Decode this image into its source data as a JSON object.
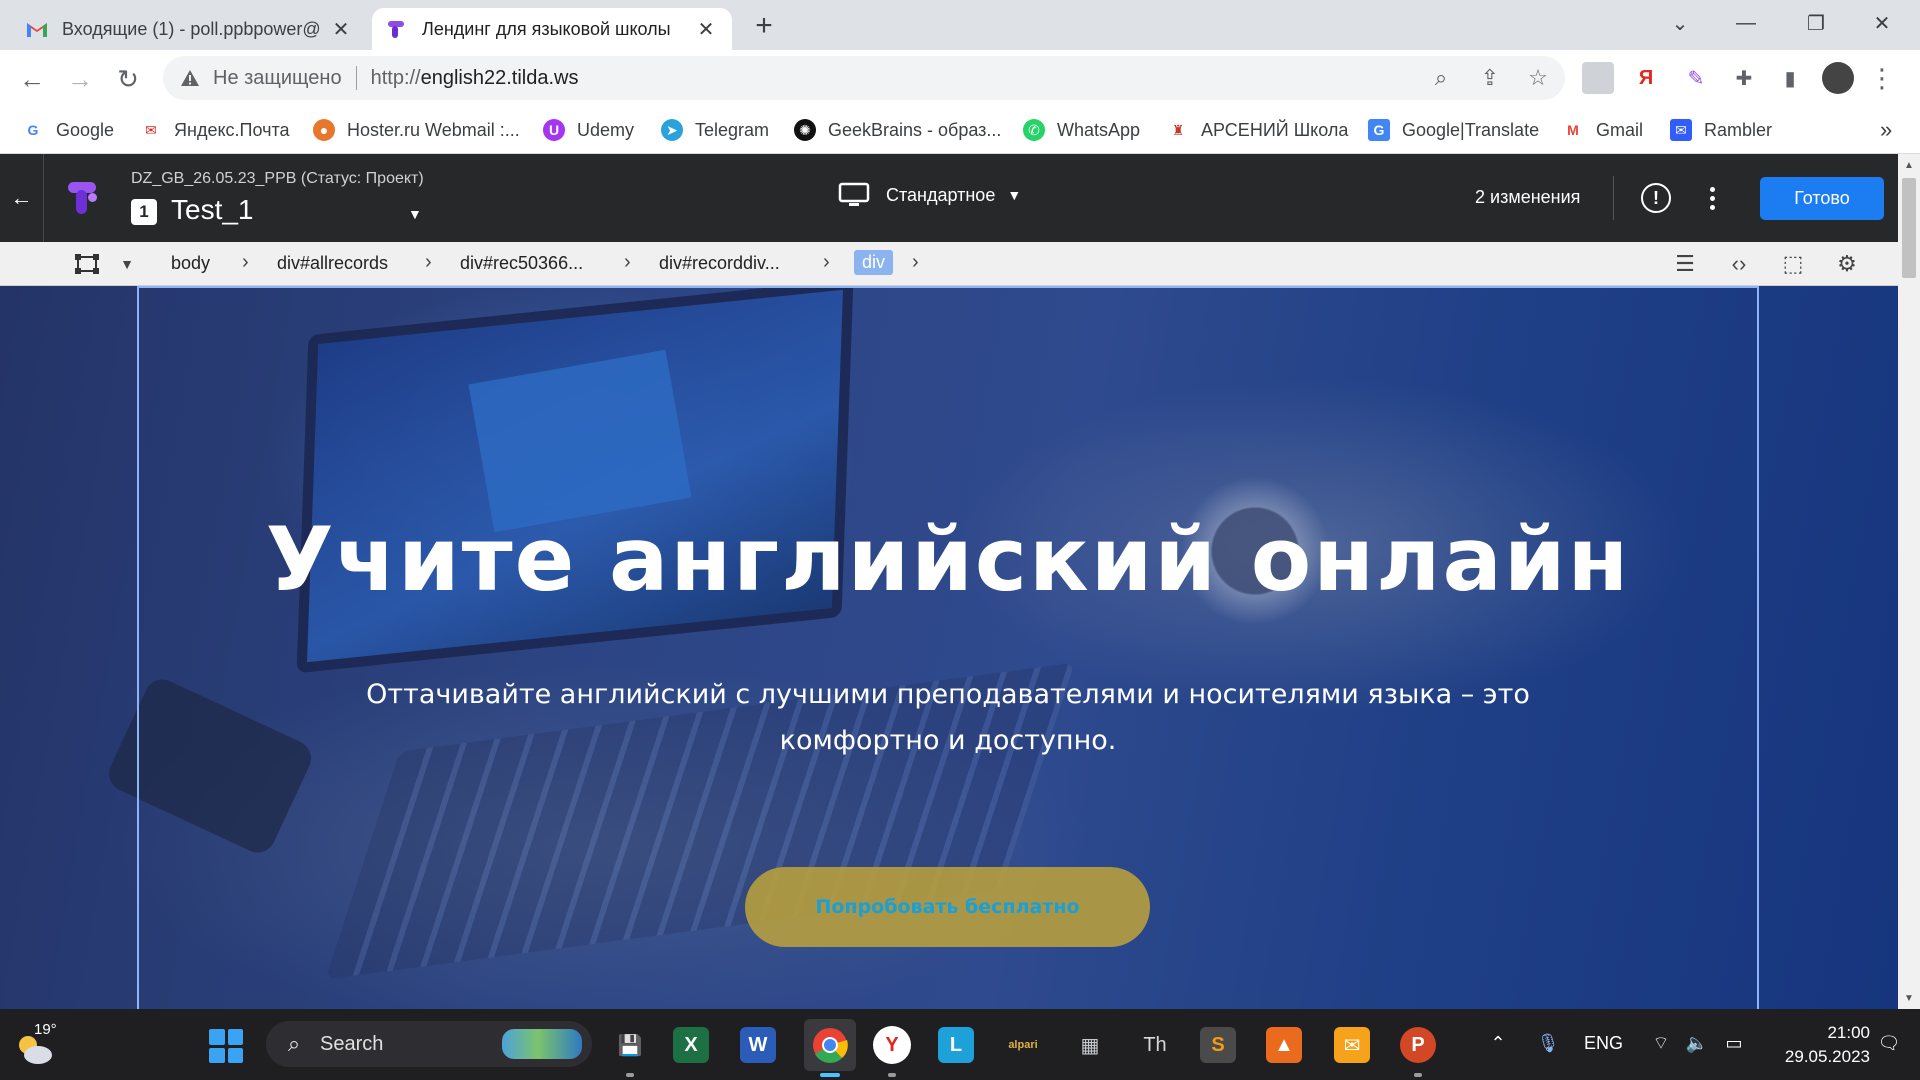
{
  "browser": {
    "tabs": [
      {
        "title": "Входящие (1) - poll.ppbpower@",
        "icon": "gmail-icon",
        "active": false
      },
      {
        "title": "Лендинг для языковой школы",
        "icon": "tilda-icon",
        "active": true
      }
    ],
    "new_tab_label": "+",
    "address": {
      "security_label": "Не защищено",
      "url_scheme": "http://",
      "url_host": "english22.tilda.ws"
    },
    "bookmarks": [
      {
        "label": "Google",
        "icon": "google-icon",
        "color": "#4285f4"
      },
      {
        "label": "Яндекс.Почта",
        "icon": "yandex-mail-icon",
        "color": "#ffcc00"
      },
      {
        "label": "Hoster.ru Webmail :...",
        "icon": "hoster-icon",
        "color": "#e8772e"
      },
      {
        "label": "Udemy",
        "icon": "udemy-icon",
        "color": "#a435f0"
      },
      {
        "label": "Telegram",
        "icon": "telegram-icon",
        "color": "#2aa3dc"
      },
      {
        "label": "GeekBrains - образ...",
        "icon": "geekbrains-icon",
        "color": "#111111"
      },
      {
        "label": "WhatsApp",
        "icon": "whatsapp-icon",
        "color": "#25d366"
      },
      {
        "label": "АРСЕНИЙ Школа",
        "icon": "arseniy-icon",
        "color": "#c0392b"
      },
      {
        "label": "Google|Translate",
        "icon": "translate-icon",
        "color": "#4285f4"
      },
      {
        "label": "Gmail",
        "icon": "gmail-icon",
        "color": "#ea4335"
      },
      {
        "label": "Rambler",
        "icon": "rambler-icon",
        "color": "#315efb"
      }
    ],
    "more_bookmarks": "»"
  },
  "editor": {
    "project_name": "DZ_GB_26.05.23_PPB (Статус: Проект)",
    "page_number": "1",
    "page_name": "Test_1",
    "device_label": "Стандартное",
    "changes_label": "2 изменения",
    "done_label": "Готово",
    "breadcrumbs": [
      "body",
      "div#allrecords",
      "div#rec50366...",
      "div#recorddiv...",
      "div"
    ]
  },
  "landing": {
    "title": "Учите английский онлайн",
    "subtitle": "Оттачивайте английский с лучшими преподавателями и носителями языка – это комфортно и доступно.",
    "cta_label": "Попробовать бесплатно",
    "cta_color": "#baa03c",
    "cta_text_color": "#1a9fd6"
  },
  "taskbar": {
    "weather_temp": "19°",
    "search_placeholder": "Search",
    "apps": [
      "file-manager-icon",
      "excel-icon",
      "word-icon",
      "chrome-icon",
      "yandex-browser-icon",
      "l-app-icon",
      "alpari-icon",
      "calculator-icon",
      "typora-icon",
      "sublime-text-icon",
      "office-icon",
      "mail-icon",
      "powerpoint-icon"
    ],
    "language": "ENG",
    "time": "21:00",
    "date": "29.05.2023"
  }
}
